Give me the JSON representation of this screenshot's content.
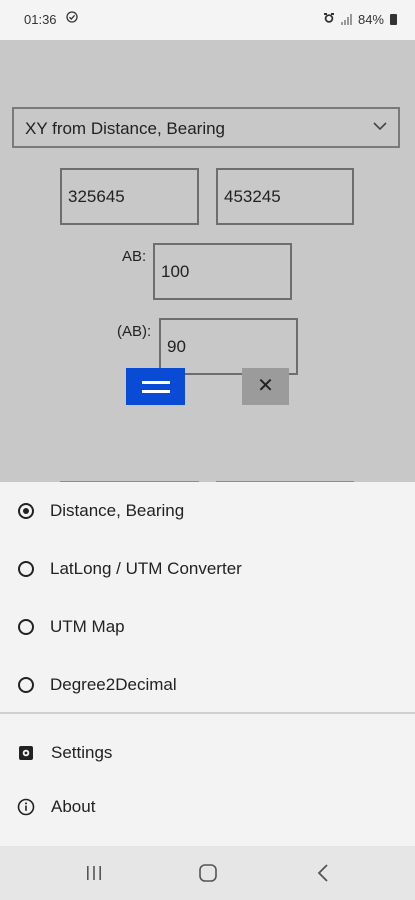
{
  "status": {
    "time": "01:36",
    "battery": "84%"
  },
  "form": {
    "dropdown_selected": "XY from Distance, Bearing",
    "x_value": "325645",
    "y_value": "453245",
    "ab_label": "AB:",
    "ab_value": "100",
    "bearing_label": "(AB):",
    "bearing_value": "90"
  },
  "menu": {
    "options": [
      {
        "label": "Distance, Bearing",
        "selected": true
      },
      {
        "label": "LatLong / UTM Converter",
        "selected": false
      },
      {
        "label": "UTM Map",
        "selected": false
      },
      {
        "label": "Degree2Decimal",
        "selected": false
      }
    ],
    "settings_label": "Settings",
    "about_label": "About"
  },
  "icons": {
    "alarm": "alarm-icon",
    "signal": "signal-icon",
    "battery": "battery-icon",
    "chevron": "chevron-down-icon",
    "calculate": "equals-icon",
    "clear": "close-icon",
    "settings": "gear-icon",
    "about": "info-icon"
  },
  "colors": {
    "accent": "#0a4bd6",
    "background": "#c8c8c8",
    "sheet": "#f3f3f3"
  }
}
